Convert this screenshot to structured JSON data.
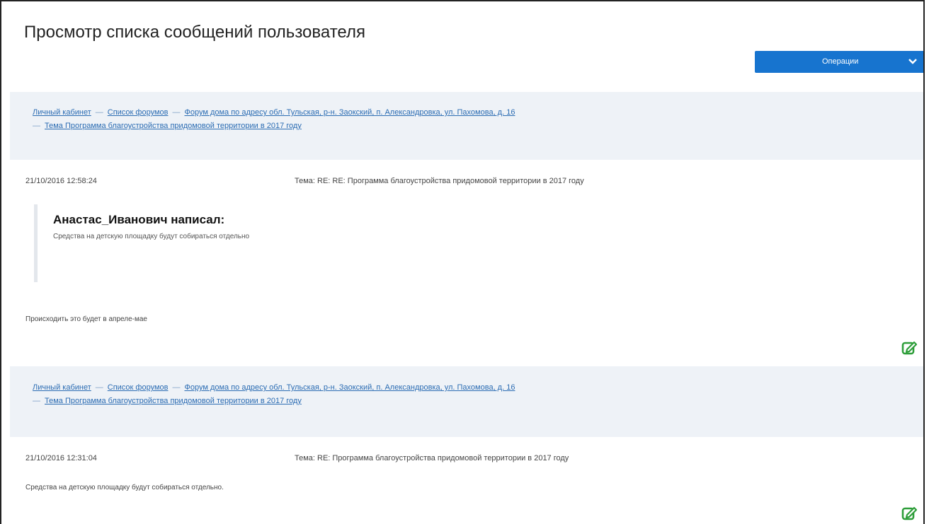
{
  "page": {
    "title": "Просмотр списка сообщений пользователя",
    "operations_label": "Операции"
  },
  "messages": [
    {
      "breadcrumbs": [
        "Личный кабинет",
        "Список форумов",
        "Форум дома по адресу обл. Тульская, р-н. Заокский, п. Александровка, ул. Пахомова, д. 16",
        "Тема Программа благоустройства придомовой территории в 2017 году"
      ],
      "date": "21/10/2016 12:58:24",
      "subject": "Тема: RE: RE: Программа благоустройства придомовой территории в 2017 году",
      "quote_author": "Анастас_Иванович написал:",
      "quote_text": "Средства на детскую площадку будут собираться отдельно",
      "body": "Происходить это будет в апреле-мае"
    },
    {
      "breadcrumbs": [
        "Личный кабинет",
        "Список форумов",
        "Форум дома по адресу обл. Тульская, р-н. Заокский, п. Александровка, ул. Пахомова, д. 16",
        "Тема Программа благоустройства придомовой территории в 2017 году"
      ],
      "date": "21/10/2016 12:31:04",
      "subject": "Тема: RE: Программа благоустройства придомовой территории в 2017 году",
      "body": "Средства на детскую площадку будут собираться отдельно."
    }
  ],
  "colors": {
    "accent": "#1774cf",
    "link": "#2b6cb3",
    "band": "#eef2f7",
    "edit_icon": "#2e9e3a"
  },
  "icons": {
    "dropdown": "chevron-down-icon",
    "edit": "edit-icon"
  }
}
